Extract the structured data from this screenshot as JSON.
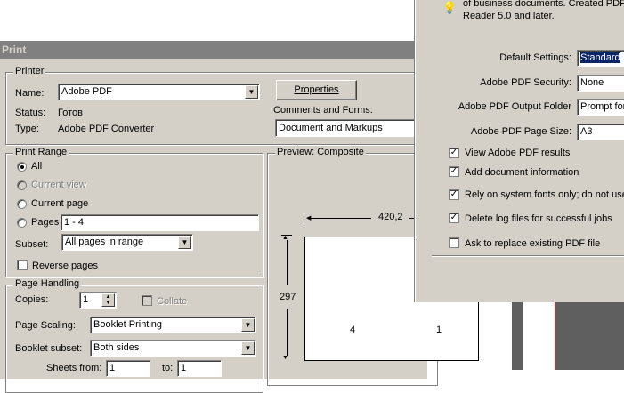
{
  "print_dialog": {
    "title": "Print",
    "printer": {
      "legend": "Printer",
      "name_label": "Name:",
      "name_value": "Adobe PDF",
      "status_label": "Status:",
      "status_value": "Готов",
      "type_label": "Type:",
      "type_value": "Adobe PDF Converter",
      "properties_button": "Properties",
      "comments_label": "Comments and Forms:",
      "comments_value": "Document and Markups"
    },
    "print_range": {
      "legend": "Print Range",
      "all": "All",
      "current_view": "Current view",
      "current_page": "Current page",
      "pages": "Pages",
      "pages_value": "1 - 4",
      "subset_label": "Subset:",
      "subset_value": "All pages in range",
      "reverse_pages": "Reverse pages"
    },
    "page_handling": {
      "legend": "Page Handling",
      "copies_label": "Copies:",
      "copies_value": "1",
      "collate": "Collate",
      "page_scaling_label": "Page Scaling:",
      "page_scaling_value": "Booklet Printing",
      "booklet_subset_label": "Booklet subset:",
      "booklet_subset_value": "Both sides",
      "sheets_from_label": "Sheets from:",
      "sheets_from_value": "1",
      "sheets_to_label": "to:",
      "sheets_to_value": "1"
    },
    "preview": {
      "legend": "Preview: Composite",
      "width_value": "420,2",
      "height_value": "297",
      "left_page": "4",
      "right_page": "1"
    }
  },
  "pdf_dialog": {
    "info_text_line1": "of business documents.  Created PDF",
    "info_text_line2": "Reader 5.0 and later.",
    "default_settings_label": "Default Settings:",
    "default_settings_value": "Standard",
    "security_label": "Adobe PDF Security:",
    "security_value": "None",
    "output_folder_label": "Adobe PDF Output Folder",
    "output_folder_value": "Prompt for",
    "page_size_label": "Adobe PDF Page Size:",
    "page_size_value": "A3",
    "options": [
      {
        "label": "View Adobe PDF results",
        "checked": true
      },
      {
        "label": "Add document information",
        "checked": true
      },
      {
        "label": "Rely on system fonts only; do not use",
        "checked": true
      },
      {
        "label": "Delete log files for successful jobs",
        "checked": true
      },
      {
        "label": "Ask to replace existing PDF file",
        "checked": false
      }
    ]
  }
}
